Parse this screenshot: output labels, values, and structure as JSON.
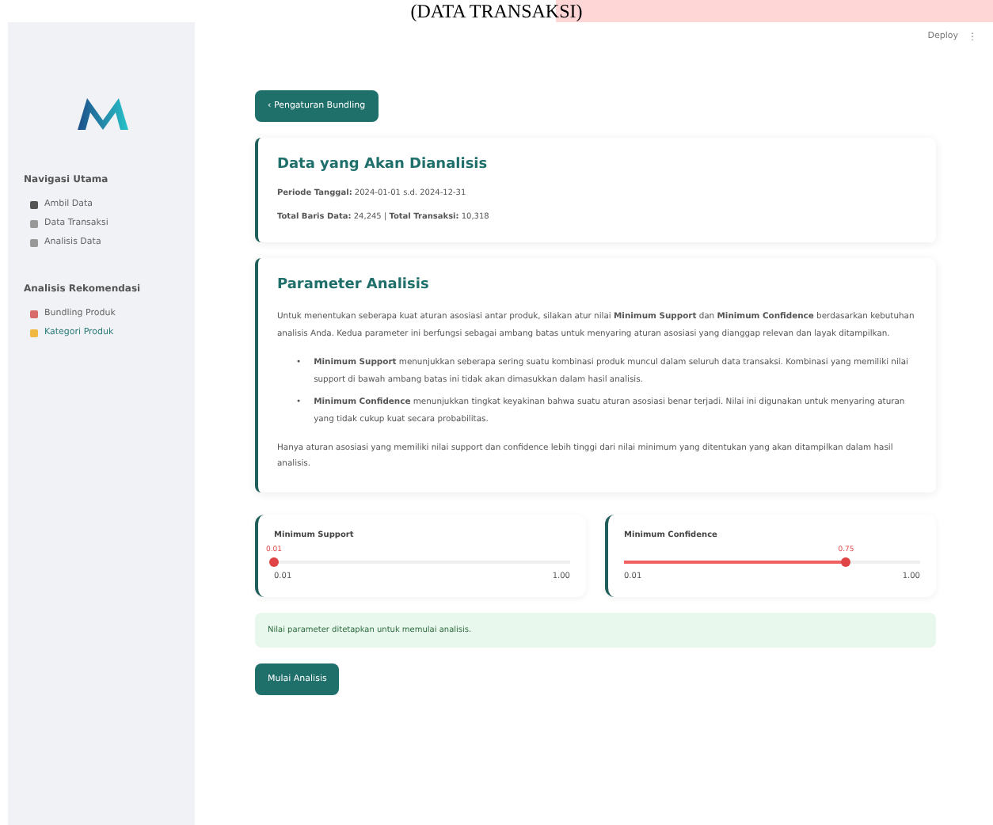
{
  "caption": "(DATA TRANSAKSI)",
  "toolbar": {
    "deploy": "Deploy",
    "menu": "⋮"
  },
  "sidebar": {
    "sections": [
      {
        "title": "Navigasi Utama",
        "items": [
          {
            "label": "Ambil Data",
            "selected": false
          },
          {
            "label": "Data Transaksi",
            "selected": false
          },
          {
            "label": "Analisis Data",
            "selected": false
          }
        ]
      },
      {
        "title": "Analisis Rekomendasi",
        "items": [
          {
            "label": "Bundling Produk",
            "selected": false
          },
          {
            "label": "Kategori Produk",
            "selected": true
          }
        ]
      }
    ]
  },
  "back_button": "‹ Pengaturan Bundling",
  "data_card": {
    "title": "Data yang Akan Dianalisis",
    "lines": [
      "**Periode Tanggal:** 2024-01-01 s.d. 2024-12-31",
      "**Total Baris Data:** 24,245 | **Total Transaksi:** 10,318"
    ]
  },
  "params_card": {
    "title": "Parameter Analisis",
    "intro": "Untuk menentukan seberapa kuat aturan asosiasi antar produk, silakan atur nilai **Minimum Support** dan **Minimum Confidence** berdasarkan kebutuhan analisis Anda. Kedua parameter ini berfungsi sebagai ambang batas untuk menyaring aturan asosiasi yang dianggap relevan dan layak ditampilkan.",
    "bullet_marker": "•",
    "bullets": [
      "**Minimum Support** menunjukkan seberapa sering suatu kombinasi produk muncul dalam seluruh data transaksi. Kombinasi yang memiliki nilai support di bawah ambang batas ini tidak akan dimasukkan dalam hasil analisis.",
      "**Minimum Confidence** menunjukkan tingkat keyakinan bahwa suatu aturan asosiasi benar terjadi. Nilai ini digunakan untuk menyaring aturan yang tidak cukup kuat secara probabilitas."
    ],
    "outro": "Hanya aturan asosiasi yang memiliki nilai support dan confidence lebih tinggi dari nilai minimum yang ditentukan yang akan ditampilkan dalam hasil analisis."
  },
  "sliders": [
    {
      "label": "Minimum Support",
      "value": "0.01",
      "min": "0.01",
      "max": "1.00",
      "level": 0.0
    },
    {
      "label": "Minimum Confidence",
      "value": "0.75",
      "min": "0.01",
      "max": "1.00",
      "level": 0.75
    }
  ],
  "info": "Nilai parameter ditetapkan untuk memulai analisis.",
  "start_button": "Mulai Analisis"
}
